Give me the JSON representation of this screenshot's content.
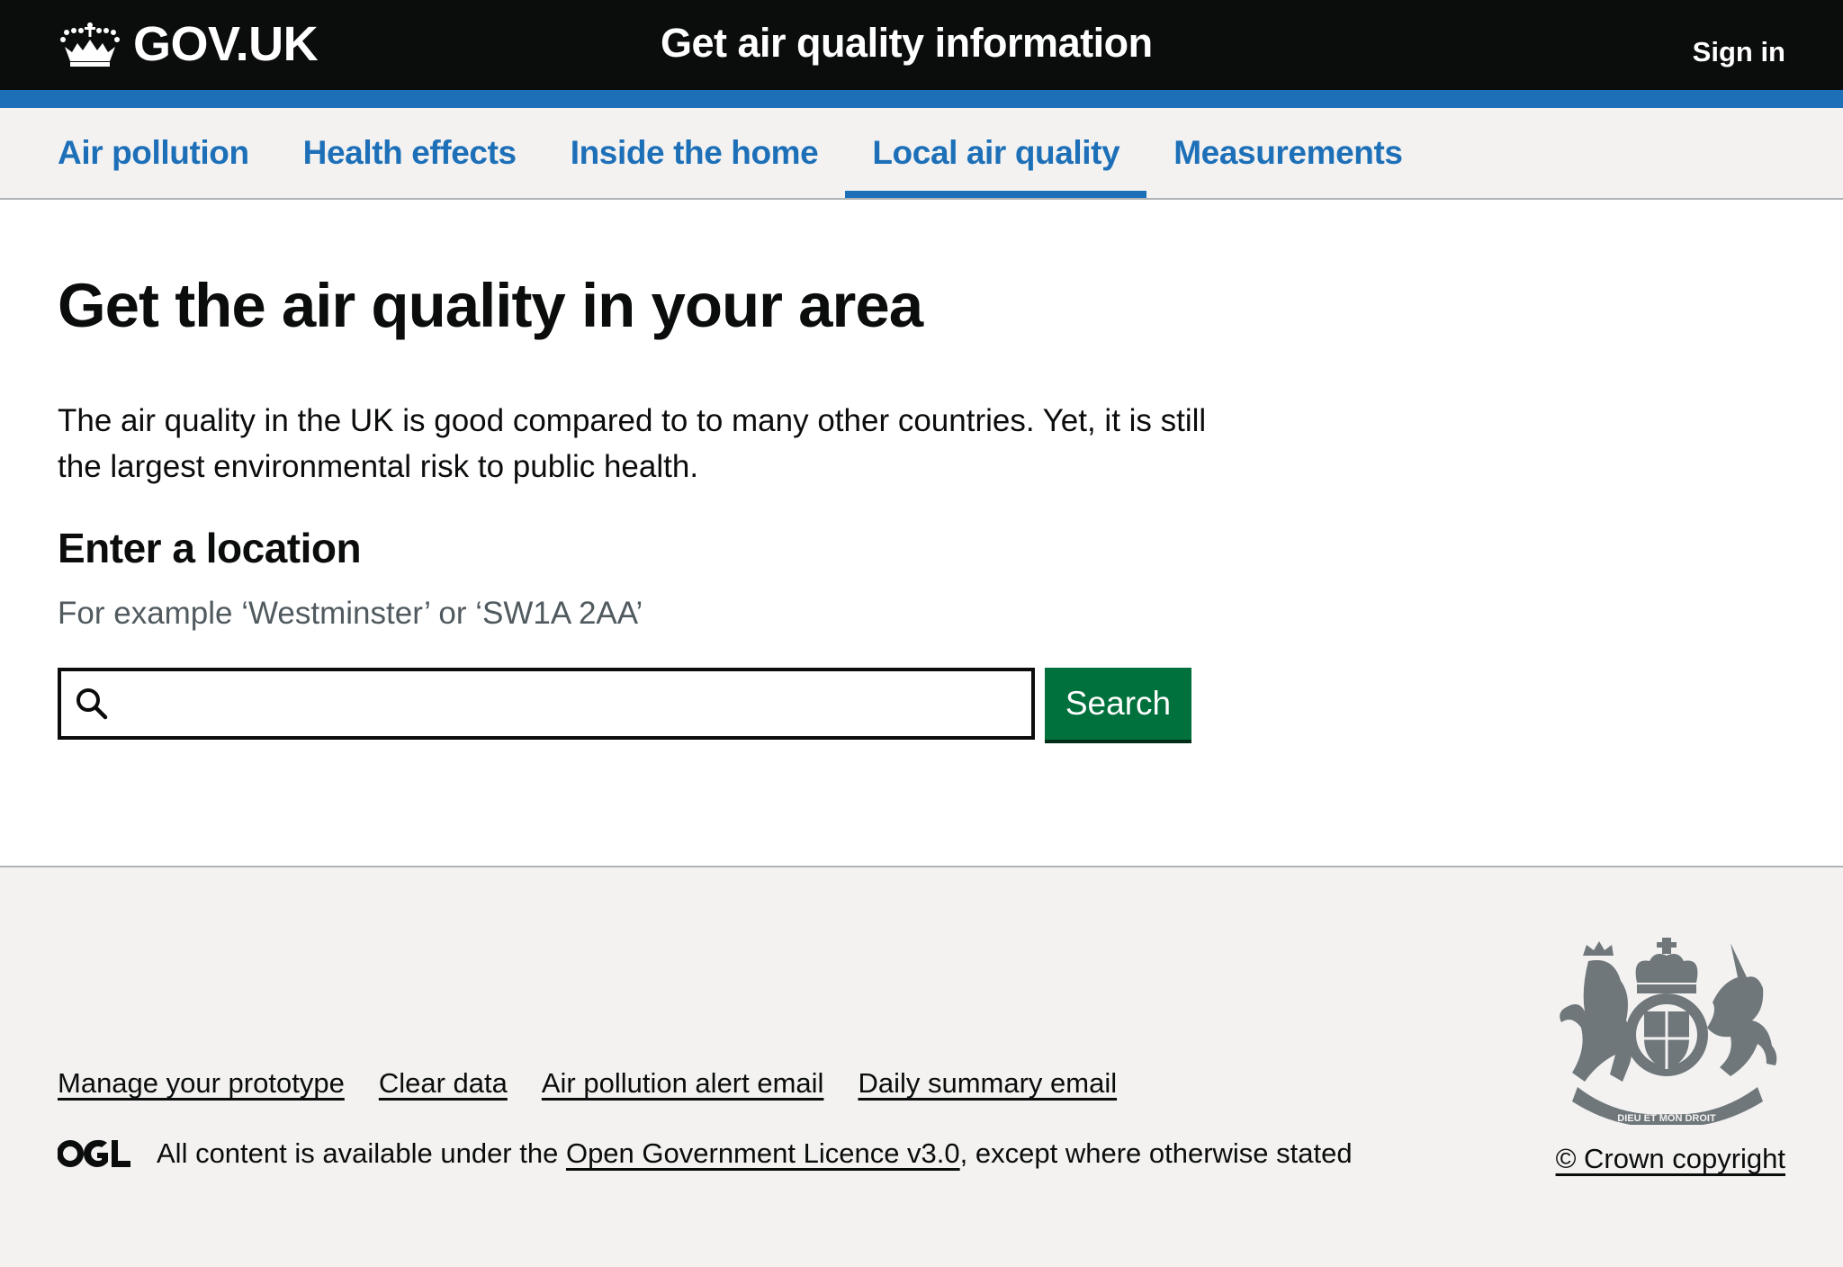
{
  "header": {
    "logo_text": "GOV.UK",
    "logo_icon": "crown-icon",
    "service_name": "Get air quality information",
    "sign_in": "Sign in"
  },
  "nav": {
    "items": [
      {
        "label": "Air pollution",
        "active": false
      },
      {
        "label": "Health effects",
        "active": false
      },
      {
        "label": "Inside the home",
        "active": false
      },
      {
        "label": "Local air quality",
        "active": true
      },
      {
        "label": "Measurements",
        "active": false
      }
    ]
  },
  "main": {
    "title": "Get the air quality in your area",
    "lede": "The air quality in the UK is good compared to to many other countries. Yet, it is still the largest environmental risk to public health.",
    "search": {
      "label": "Enter a location",
      "hint": "For example ‘Westminster’ or ‘SW1A 2AA’",
      "value": "",
      "placeholder": "",
      "icon": "search-icon",
      "button_label": "Search"
    }
  },
  "footer": {
    "links": [
      "Manage your prototype",
      "Clear data",
      "Air pollution alert email",
      "Daily summary email"
    ],
    "licence_prefix": "All content is available under the ",
    "licence_link": "Open Government Licence v3.0",
    "licence_suffix": ", except where otherwise stated",
    "ogl_logo": "ogl-logo",
    "crest_icon": "royal-coat-of-arms",
    "copyright": "© Crown copyright"
  },
  "colors": {
    "header_bg": "#0b0c0c",
    "brand_blue": "#1d70b8",
    "nav_bg": "#f3f2f1",
    "button_green": "#00703c",
    "hint_grey": "#505a5f",
    "crest_grey": "#6f777b"
  }
}
